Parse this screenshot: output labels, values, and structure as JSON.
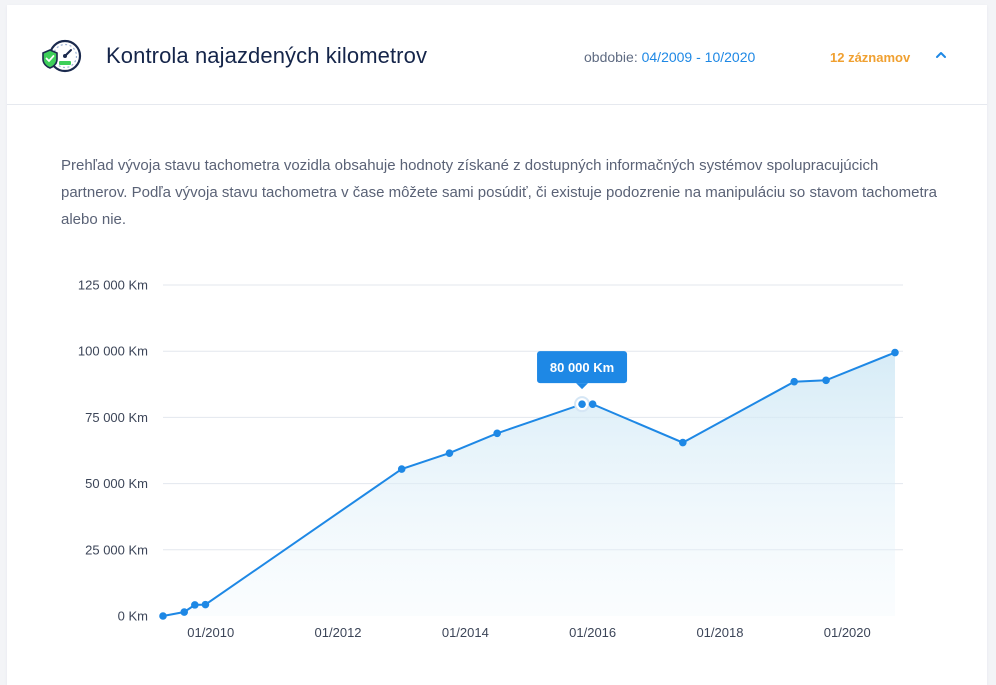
{
  "header": {
    "title": "Kontrola najazdených kilometrov",
    "period_label": "obdobie:",
    "period_value": "04/2009 - 10/2020",
    "count": "12 záznamov",
    "icon": "speedometer-shield-icon",
    "collapse_icon": "chevron-up-icon"
  },
  "description": "Prehľad vývoja stavu tachometra vozidla obsahuje hodnoty získané z dostupných informačných systémov spolupracujúcich partnerov. Podľa vývoja stavu tachometra v čase môžete sami posúdiť, či existuje podozrenie na manipuláciu so stavom tachometra alebo nie.",
  "colors": {
    "accent": "#1e88e5",
    "count": "#f0a030",
    "tooltip": "#1e88e5"
  },
  "chart_data": {
    "type": "area",
    "x_axis_type": "date",
    "y_unit": "Km",
    "ylim": [
      0,
      125000
    ],
    "y_ticks": [
      0,
      25000,
      50000,
      75000,
      100000,
      125000
    ],
    "y_tick_labels": [
      "0 Km",
      "25 000 Km",
      "50 000 Km",
      "75 000 Km",
      "100 000 Km",
      "125 000 Km"
    ],
    "x_ticks": [
      "01/2010",
      "01/2012",
      "01/2014",
      "01/2016",
      "01/2018",
      "01/2020"
    ],
    "grid": true,
    "points": [
      {
        "x": "2009-04",
        "y": 0
      },
      {
        "x": "2009-08",
        "y": 1500
      },
      {
        "x": "2009-10",
        "y": 4200
      },
      {
        "x": "2009-12",
        "y": 4300
      },
      {
        "x": "2013-01",
        "y": 55500
      },
      {
        "x": "2013-10",
        "y": 61500
      },
      {
        "x": "2014-07",
        "y": 69000
      },
      {
        "x": "2015-11",
        "y": 80000
      },
      {
        "x": "2016-01",
        "y": 80000
      },
      {
        "x": "2017-06",
        "y": 65500
      },
      {
        "x": "2019-03",
        "y": 88500
      },
      {
        "x": "2019-09",
        "y": 89000
      },
      {
        "x": "2020-10",
        "y": 99500
      }
    ],
    "tooltip": {
      "label": "80 000 Km",
      "point_index": 7
    }
  }
}
